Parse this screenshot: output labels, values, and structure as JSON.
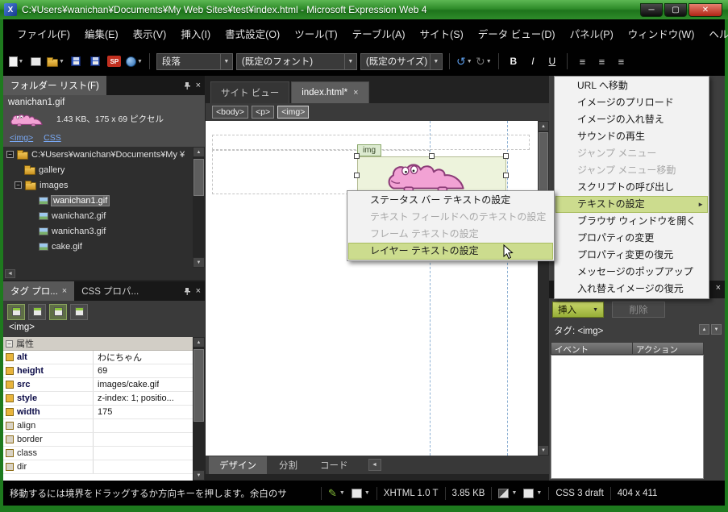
{
  "titlebar": {
    "title": "C:¥Users¥wanichan¥Documents¥My Web Sites¥test¥index.html - Microsoft Expression Web 4",
    "app_initial": "X"
  },
  "menubar": {
    "items": [
      {
        "label": "ファイル(F)"
      },
      {
        "label": "編集(E)"
      },
      {
        "label": "表示(V)"
      },
      {
        "label": "挿入(I)"
      },
      {
        "label": "書式設定(O)"
      },
      {
        "label": "ツール(T)"
      },
      {
        "label": "テーブル(A)"
      },
      {
        "label": "サイト(S)"
      },
      {
        "label": "データ ビュー(D)"
      },
      {
        "label": "パネル(P)"
      },
      {
        "label": "ウィンドウ(W)"
      },
      {
        "label": "ヘルプ(H)"
      }
    ]
  },
  "toolbar": {
    "sp": "SP",
    "style_combo": "段落",
    "font_combo": "(既定のフォント)",
    "size_combo": "(既定のサイズ)",
    "bold": "B",
    "italic": "I",
    "underline": "U"
  },
  "folder_panel": {
    "title": "フォルダー リスト(F)",
    "preview": {
      "filename": "wanichan1.gif",
      "info": "1.43 KB、175 x 69 ピクセル",
      "img_link": "<img>",
      "css_link": "CSS"
    },
    "tree": [
      {
        "label": "C:¥Users¥wanichan¥Documents¥My ¥"
      },
      {
        "label": "gallery"
      },
      {
        "label": "images"
      },
      {
        "label": "wanichan1.gif"
      },
      {
        "label": "wanichan2.gif"
      },
      {
        "label": "wanichan3.gif"
      },
      {
        "label": "cake.gif"
      }
    ]
  },
  "tag_panel": {
    "tab1": "タグ プロ...",
    "tab2": "CSS プロパ...",
    "tag": "<img>",
    "section": "属性",
    "rows": [
      {
        "name": "alt",
        "value": "わにちゃん"
      },
      {
        "name": "height",
        "value": "69"
      },
      {
        "name": "src",
        "value": "images/cake.gif"
      },
      {
        "name": "style",
        "value": "z-index: 1; positio..."
      },
      {
        "name": "width",
        "value": "175"
      },
      {
        "name": "align",
        "value": ""
      },
      {
        "name": "border",
        "value": ""
      },
      {
        "name": "class",
        "value": ""
      },
      {
        "name": "dir",
        "value": ""
      }
    ]
  },
  "editor": {
    "tab1": "サイト ビュー",
    "tab2": "index.html*",
    "tab2_close": "×",
    "breadcrumb": [
      "<body>",
      "<p>",
      "<img>"
    ],
    "img_label": "img",
    "view_tabs": [
      "デザイン",
      "分割",
      "コード"
    ]
  },
  "behaviors": {
    "insert": "挿入",
    "delete": "削除",
    "tag": "タグ: <img>",
    "col_event": "イベント",
    "col_action": "アクション"
  },
  "menu": {
    "items": [
      {
        "label": "URL へ移動"
      },
      {
        "label": "イメージのプリロード"
      },
      {
        "label": "イメージの入れ替え"
      },
      {
        "label": "サウンドの再生"
      },
      {
        "label": "ジャンプ メニュー"
      },
      {
        "label": "ジャンプ メニュー移動"
      },
      {
        "label": "スクリプトの呼び出し"
      },
      {
        "label": "テキストの設定"
      },
      {
        "label": "ブラウザ ウィンドウを開く"
      },
      {
        "label": "プロパティの変更"
      },
      {
        "label": "プロパティ変更の復元"
      },
      {
        "label": "メッセージのポップアップ"
      },
      {
        "label": "入れ替えイメージの復元"
      }
    ]
  },
  "submenu": {
    "items": [
      {
        "label": "ステータス バー テキストの設定"
      },
      {
        "label": "テキスト フィールドへのテキストの設定"
      },
      {
        "label": "フレーム テキストの設定"
      },
      {
        "label": "レイヤー テキストの設定"
      }
    ]
  },
  "statusbar": {
    "message": "移動するには境界をドラッグするか方向キーを押します。余白のサ",
    "doctype": "XHTML 1.0 T",
    "size": "3.85 KB",
    "css": "CSS 3 draft",
    "dims": "404 x 411"
  }
}
